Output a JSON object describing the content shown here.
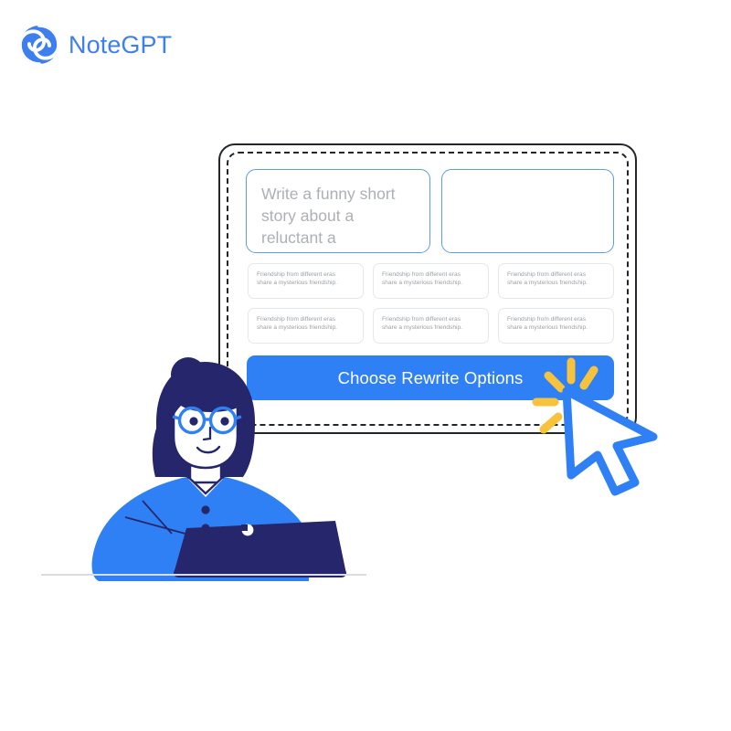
{
  "brand": {
    "name": "NoteGPT",
    "logo_icon": "spiral-swirl-icon",
    "color": "#3D7FEF"
  },
  "panel": {
    "prompt": {
      "filled_box": {
        "value": "Write a funny short\nstory about a\nreluctant a",
        "placeholder": "Write a funny short story about a reluctant a"
      },
      "empty_box": {
        "value": "",
        "placeholder": ""
      }
    },
    "cards": [
      {
        "text": "Friendship from different eras\nshare a mysterious friendship."
      },
      {
        "text": "Friendship from different eras\nshare a mysterious friendship."
      },
      {
        "text": "Friendship from different eras\nshare a mysterious friendship."
      },
      {
        "text": "Friendship from different eras\nshare a mysterious friendship."
      },
      {
        "text": "Friendship from different eras\nshare a mysterious friendship."
      },
      {
        "text": "Friendship from different eras\nshare a mysterious friendship."
      }
    ],
    "cta": {
      "label": "Choose Rewrite Options",
      "background": "#2F80F5",
      "text_color": "#FFFFFF"
    }
  },
  "illustration": {
    "cursor_icon": "mouse-pointer-arrow-icon",
    "sparkle_icon": "click-sparkle-burst-icon",
    "person_icon": "woman-with-laptop-illustration",
    "laptop_icon": "laptop-icon",
    "glasses_icon": "eyeglasses-icon"
  },
  "colors": {
    "brand_blue": "#3D7FEF",
    "accent_blue": "#2F80F5",
    "cursor_outline": "#2F80F5",
    "sparkle_yellow": "#F7C23C",
    "navy": "#25266B",
    "shirt_blue": "#2F80F5",
    "panel_border": "#22262b",
    "card_border": "#E4E8EC",
    "placeholder_gray": "#ACB0B5",
    "ground_line": "#D9DCE4"
  }
}
